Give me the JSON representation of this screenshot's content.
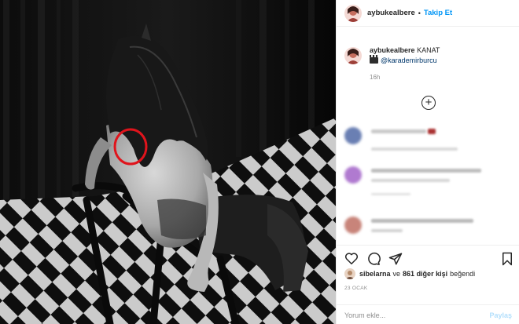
{
  "post": {
    "username": "aybukealbere",
    "separator": "•",
    "follow_label": "Takip Et"
  },
  "caption": {
    "username": "aybukealbere",
    "text": "KANAT",
    "credit_icon": "clapperboard-emoji",
    "mention": "@karademirburcu",
    "time": "16h"
  },
  "load_more_icon": "plus-circle-icon",
  "comments": [
    {
      "avatar_color": "#6a7fb3",
      "line_colors": [
        "#c9c9c9",
        "#d8d8d8"
      ]
    },
    {
      "avatar_color": "#b07ad0",
      "line_colors": [
        "#bdbdbd",
        "#d5d5d5"
      ]
    },
    {
      "avatar_color": "#c8847a",
      "line_colors": [
        "#b9b9b9",
        "#d2d2d2"
      ]
    }
  ],
  "actions": {
    "like_icon": "heart-icon",
    "comment_icon": "comment-icon",
    "share_icon": "share-icon",
    "save_icon": "bookmark-icon"
  },
  "likes": {
    "user": "sibelarna",
    "connector": "ve",
    "count_text": "861 diğer kişi",
    "suffix": "beğendi"
  },
  "date": "23 OCAK",
  "add_comment": {
    "placeholder": "Yorum ekle...",
    "post_label": "Paylaş"
  },
  "colors": {
    "accent": "#0095f6",
    "highlight_circle": "#e0141c"
  }
}
